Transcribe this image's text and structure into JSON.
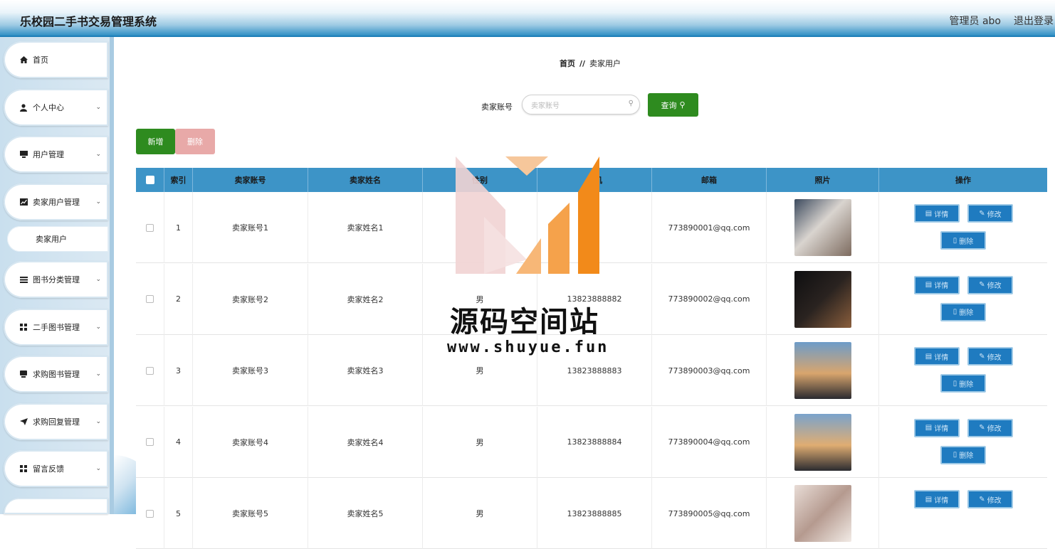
{
  "header": {
    "title": "乐校园二手书交易管理系统",
    "admin_label": "管理员 abo",
    "logout_label": "退出登录"
  },
  "sidebar": {
    "items": [
      {
        "label": "首页",
        "icon": "home-icon",
        "has_children": false
      },
      {
        "label": "个人中心",
        "icon": "user-icon",
        "has_children": true
      },
      {
        "label": "用户管理",
        "icon": "monitor-icon",
        "has_children": true
      },
      {
        "label": "卖家用户管理",
        "icon": "chart-icon",
        "has_children": true
      },
      {
        "label": "图书分类管理",
        "icon": "list-icon",
        "has_children": true
      },
      {
        "label": "二手图书管理",
        "icon": "grid-icon",
        "has_children": true
      },
      {
        "label": "求购图书管理",
        "icon": "book-icon",
        "has_children": true
      },
      {
        "label": "求购回复管理",
        "icon": "send-icon",
        "has_children": true
      },
      {
        "label": "留言反馈",
        "icon": "grid-icon",
        "has_children": true
      }
    ],
    "sub_item": {
      "label": "卖家用户"
    }
  },
  "breadcrumb": {
    "home": "首页",
    "separator": "//",
    "current": "卖家用户"
  },
  "search": {
    "label": "卖家账号",
    "placeholder": "卖家账号",
    "value": "",
    "button_label": "查询"
  },
  "toolbar": {
    "add_label": "新增",
    "delete_label": "删除"
  },
  "table": {
    "columns": [
      "索引",
      "卖家账号",
      "卖家姓名",
      "性别",
      "手机",
      "邮箱",
      "照片",
      "操作"
    ],
    "rows": [
      {
        "index": "1",
        "account": "卖家账号1",
        "name": "卖家姓名1",
        "gender": "",
        "phone": "",
        "email": "773890001@qq.com"
      },
      {
        "index": "2",
        "account": "卖家账号2",
        "name": "卖家姓名2",
        "gender": "男",
        "phone": "13823888882",
        "email": "773890002@qq.com"
      },
      {
        "index": "3",
        "account": "卖家账号3",
        "name": "卖家姓名3",
        "gender": "男",
        "phone": "13823888883",
        "email": "773890003@qq.com"
      },
      {
        "index": "4",
        "account": "卖家账号4",
        "name": "卖家姓名4",
        "gender": "男",
        "phone": "13823888884",
        "email": "773890004@qq.com"
      },
      {
        "index": "5",
        "account": "卖家账号5",
        "name": "卖家姓名5",
        "gender": "男",
        "phone": "13823888885",
        "email": "773890005@qq.com"
      }
    ],
    "actions": {
      "detail": "详情",
      "edit": "修改",
      "delete": "删除"
    }
  },
  "watermark": {
    "text": "源码空间站",
    "url": "www.shuyue.fun"
  },
  "colors": {
    "header_blue": "#2f8fc4",
    "table_header": "#3d94c7",
    "primary_green": "#2e8b1f",
    "delete_pink": "#e8a9a8",
    "action_blue": "#1f7bc0"
  }
}
